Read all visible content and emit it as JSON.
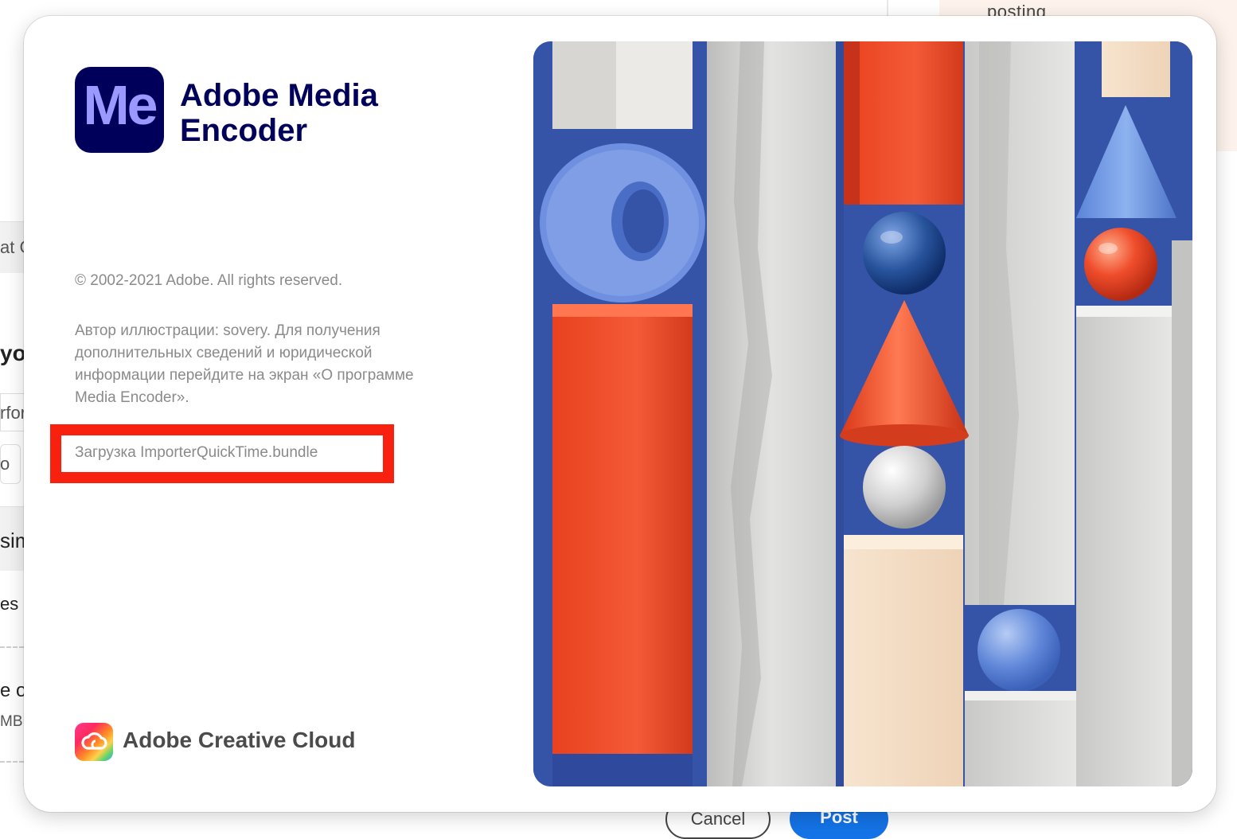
{
  "background_page": {
    "top_right_text": "posting",
    "left_fragments": [
      "at C",
      "yo",
      "rfor",
      "o",
      "sim",
      "es",
      "e o",
      "MB ‹"
    ],
    "cancel_label": "Cancel",
    "post_label": "Post"
  },
  "splash": {
    "app_icon_letters": "Me",
    "app_name": "Adobe Media Encoder",
    "copyright": "© 2002-2021 Adobe. All rights reserved.",
    "credits": "Автор иллюстрации: sovery. Для получения дополнительных сведений и юридической информации перейдите на экран «О программе Media Encoder».",
    "loading_status": "Загрузка ImporterQuickTime.bundle",
    "footer_brand": "Adobe Creative Cloud",
    "icons": {
      "app": "media-encoder-app-icon",
      "footer": "creative-cloud-icon"
    }
  },
  "colors": {
    "brand_dark": "#00005b",
    "brand_light": "#9999ff",
    "highlight_red": "#f8200f",
    "art_blue": "#3553a7",
    "art_orange": "#f04a2a",
    "post_blue": "#1473e6"
  }
}
